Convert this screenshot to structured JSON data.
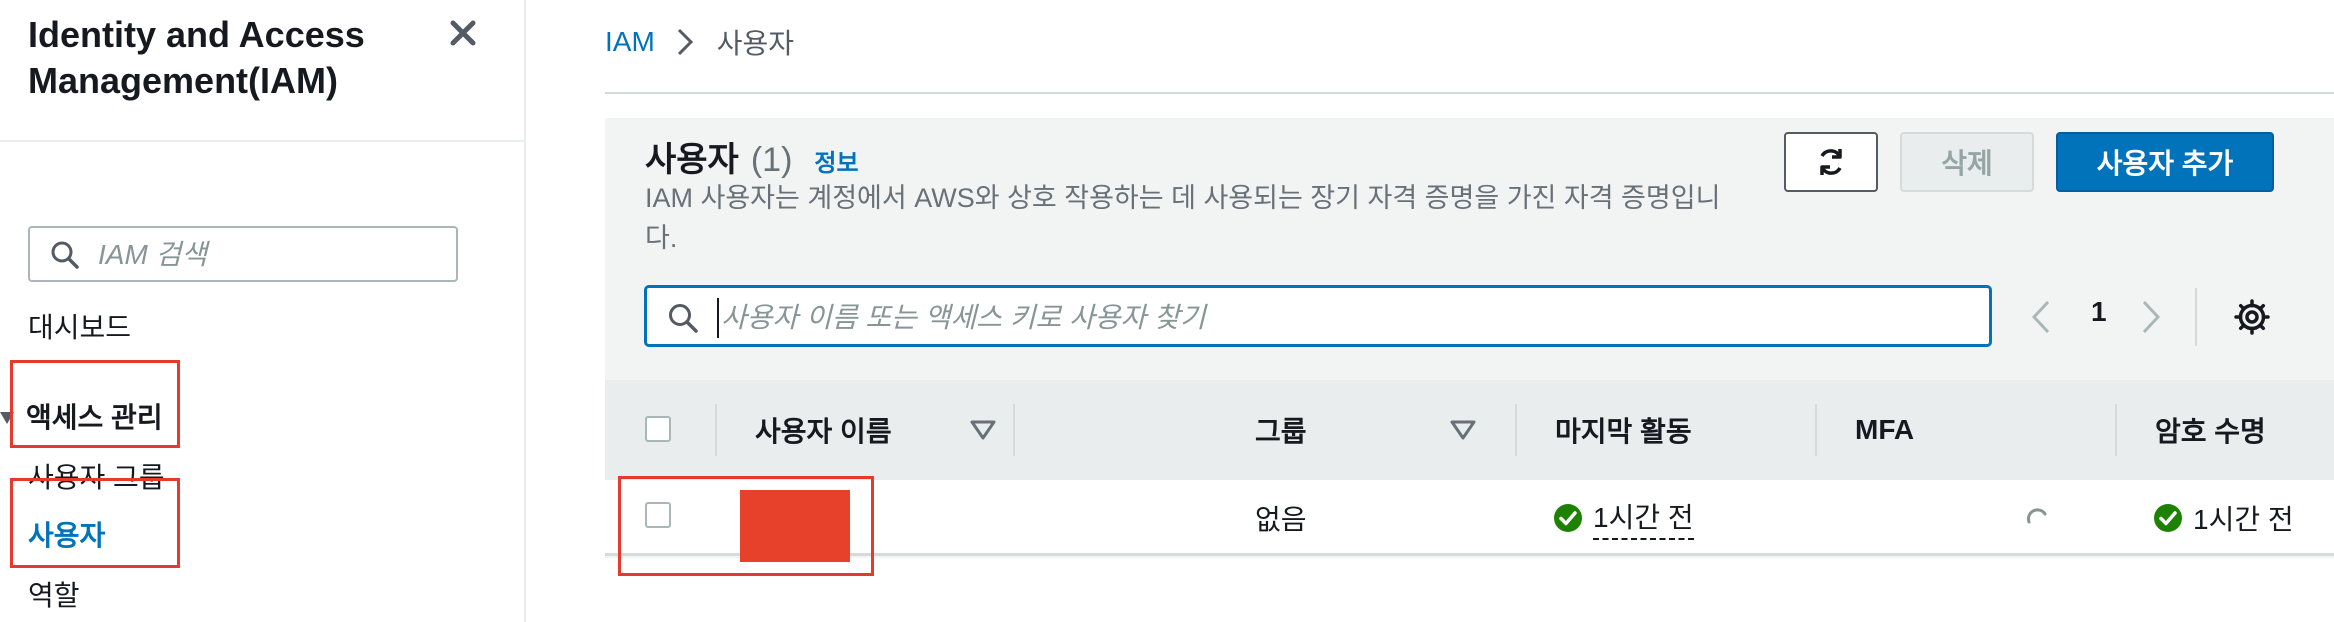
{
  "sidebar": {
    "title": "Identity and Access Management(IAM)",
    "search_placeholder": "IAM 검색",
    "dashboard": "대시보드",
    "access_section": "액세스 관리",
    "items": {
      "user_groups": "사용자 그룹",
      "users": "사용자",
      "roles": "역할"
    }
  },
  "breadcrumb": {
    "root": "IAM",
    "current": "사용자"
  },
  "panel": {
    "title": "사용자",
    "count": "(1)",
    "info_link": "정보",
    "description": "IAM 사용자는 계정에서 AWS와 상호 작용하는 데 사용되는 장기 자격 증명을 가진 자격 증명입니다.",
    "delete_label": "삭제",
    "add_label": "사용자 추가",
    "filter_placeholder": "사용자 이름 또는 액세스 키로 사용자 찾기",
    "page_number": "1"
  },
  "table": {
    "columns": {
      "username": "사용자 이름",
      "group": "그룹",
      "last_activity": "마지막 활동",
      "mfa": "MFA",
      "password_age": "암호 수명"
    },
    "rows": [
      {
        "group": "없음",
        "last_activity": "1시간 전",
        "password_age": "1시간 전"
      }
    ]
  },
  "colors": {
    "link": "#0073bb",
    "primary_button": "#0073bb",
    "success": "#1d8102",
    "highlight": "#e53a2c",
    "redaction": "#e8412b"
  },
  "icons": [
    "close-icon",
    "search-icon",
    "caret-down-icon",
    "refresh-icon",
    "chevron-left-icon",
    "chevron-right-icon",
    "gear-icon",
    "sort-icon",
    "check-circle-icon",
    "loading-icon"
  ]
}
